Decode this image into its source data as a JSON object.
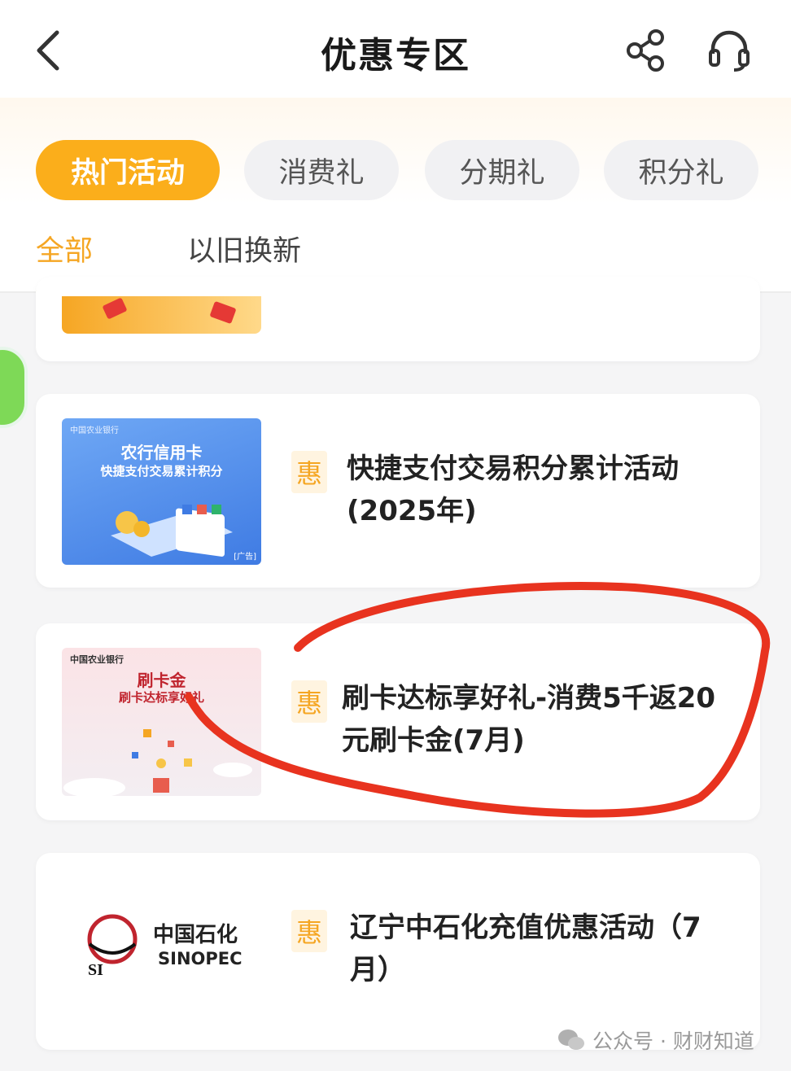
{
  "header": {
    "title": "优惠专区",
    "back_icon": "chevron-left-icon",
    "share_icon": "share-icon",
    "service_icon": "headset-icon"
  },
  "category_tabs": [
    {
      "label": "热门活动",
      "active": true
    },
    {
      "label": "消费礼",
      "active": false
    },
    {
      "label": "分期礼",
      "active": false
    },
    {
      "label": "积分礼",
      "active": false
    }
  ],
  "sub_tabs": [
    {
      "label": "全部",
      "active": true
    },
    {
      "label": "以旧换新",
      "active": false
    }
  ],
  "items": [
    {
      "badge": "惠",
      "title_line1": "快捷支付交易积分累计活动",
      "title_line2": "(2025年)",
      "thumb": {
        "bank": "中国农业银行",
        "line1": "农行信用卡",
        "line2": "快捷支付交易累计积分",
        "tag": "[广告]"
      }
    },
    {
      "badge": "惠",
      "title_line1": "刷卡达标享好礼-消费5千返20",
      "title_line2": "元刷卡金(7月)",
      "thumb": {
        "bank": "中国农业银行",
        "line1": "刷卡金",
        "line2": "刷卡达标享好礼"
      }
    },
    {
      "badge": "惠",
      "title_line1": "辽宁中石化充值优惠活动（7",
      "title_line2": "月）",
      "thumb": {
        "logo_cn": "中国石化",
        "logo_en": "SINOPEC"
      }
    }
  ],
  "watermark": "公众号 · 财财知道",
  "colors": {
    "accent": "#fbae1b",
    "annotation": "#e8331f",
    "badge_bg": "#fff4e0"
  }
}
